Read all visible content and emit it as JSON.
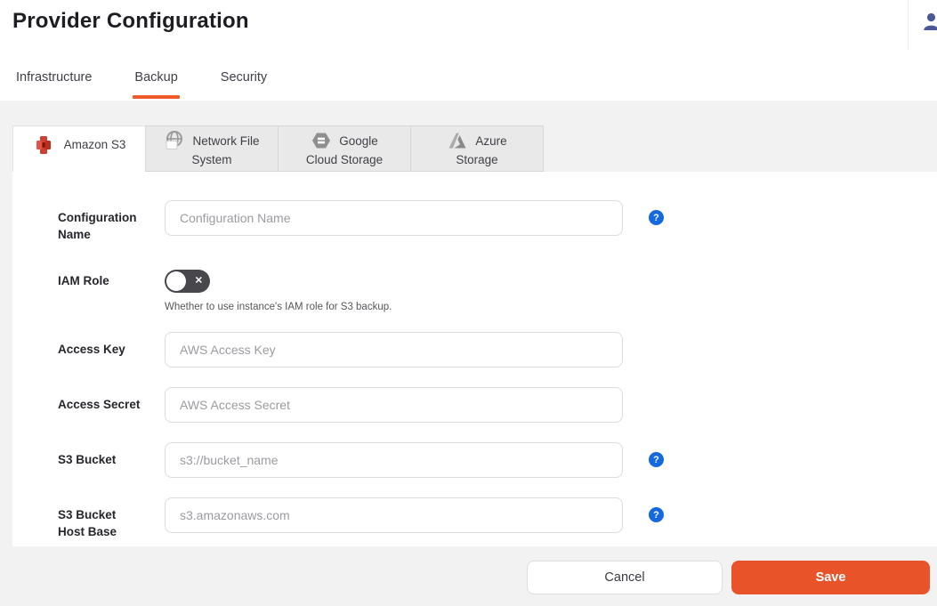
{
  "header": {
    "title": "Provider Configuration"
  },
  "nav_tabs": {
    "items": [
      {
        "label": "Infrastructure",
        "active": false
      },
      {
        "label": "Backup",
        "active": true
      },
      {
        "label": "Security",
        "active": false
      }
    ]
  },
  "provider_tabs": [
    {
      "label": "Amazon S3",
      "lines": [
        "Amazon S3"
      ],
      "icon": "amazon-s3-icon",
      "active": true
    },
    {
      "label": "Network File System",
      "lines": [
        "Network File",
        "System"
      ],
      "icon": "network-file-system-icon",
      "active": false
    },
    {
      "label": "Google Cloud Storage",
      "lines": [
        "Google",
        "Cloud Storage"
      ],
      "icon": "google-cloud-storage-icon",
      "active": false
    },
    {
      "label": "Azure Storage",
      "lines": [
        "Azure",
        "Storage"
      ],
      "icon": "azure-storage-icon",
      "active": false
    }
  ],
  "form": {
    "fields": [
      {
        "id": "configuration_name",
        "label": "Configuration Name",
        "label_lines": [
          "Configuration",
          "Name"
        ],
        "type": "text",
        "value": "",
        "placeholder": "Configuration Name",
        "has_help": true
      },
      {
        "id": "iam_role",
        "label": "IAM Role",
        "label_lines": [
          "IAM Role"
        ],
        "type": "toggle",
        "value": "off",
        "help_text": "Whether to use instance's IAM role for S3 backup."
      },
      {
        "id": "access_key",
        "label": "Access Key",
        "label_lines": [
          "Access Key"
        ],
        "type": "text",
        "value": "",
        "placeholder": "AWS Access Key",
        "has_help": false
      },
      {
        "id": "access_secret",
        "label": "Access Secret",
        "label_lines": [
          "Access Secret"
        ],
        "type": "text",
        "value": "",
        "placeholder": "AWS Access Secret",
        "has_help": false
      },
      {
        "id": "s3_bucket",
        "label": "S3 Bucket",
        "label_lines": [
          "S3 Bucket"
        ],
        "type": "text",
        "value": "",
        "placeholder": "s3://bucket_name",
        "has_help": true
      },
      {
        "id": "s3_bucket_host_base",
        "label": "S3 Bucket Host Base",
        "label_lines": [
          "S3 Bucket",
          "Host Base"
        ],
        "type": "text",
        "value": "",
        "placeholder": "s3.amazonaws.com",
        "has_help": true
      }
    ]
  },
  "footer": {
    "cancel_label": "Cancel",
    "save_label": "Save"
  },
  "colors": {
    "accent_orange": "#e8532a",
    "tab_underline_orange": "#f05a28",
    "help_blue": "#1568e0",
    "toggle_off_bg": "#47474c",
    "user_icon_navy": "#4c5798",
    "panel_white": "#ffffff",
    "page_gray": "#f2f2f3",
    "inactive_tab_gray": "#e9e9ea"
  }
}
